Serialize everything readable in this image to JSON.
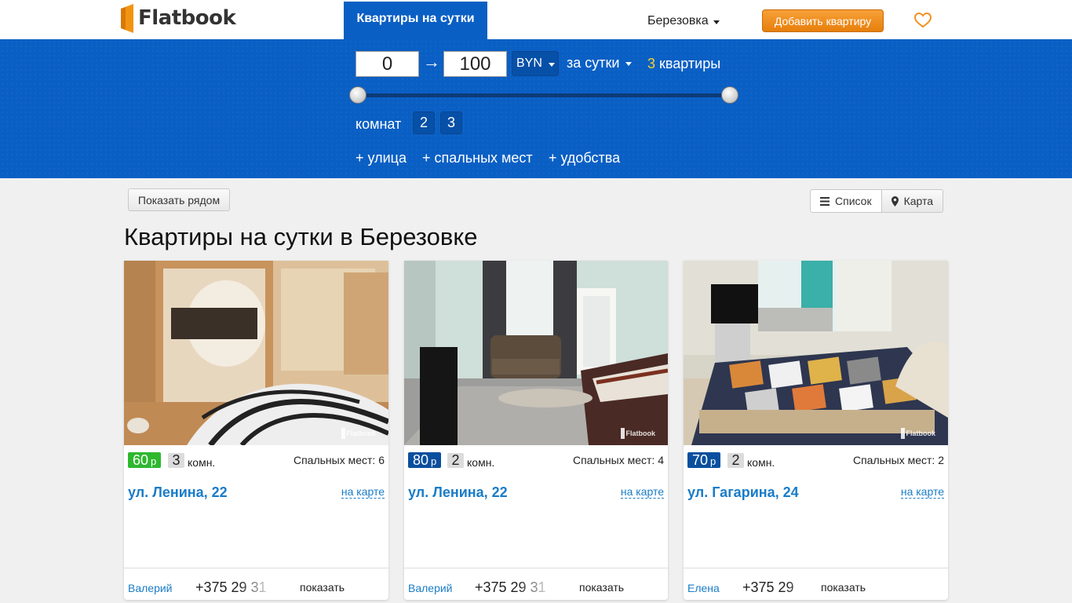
{
  "header": {
    "logo_text": "Flatbook",
    "nav_tab": "Квартиры на сутки",
    "city": "Березовка",
    "add_button": "Добавить квартиру"
  },
  "filters": {
    "price_from": "0",
    "arrow": "→",
    "price_to": "100",
    "currency": "BYN",
    "period": "за сутки",
    "count_number": "3",
    "count_label": "квартиры",
    "slider": {
      "min": 0,
      "max": 100
    },
    "rooms_label": "комнат",
    "rooms": [
      "2",
      "3"
    ],
    "extras": [
      "+ улица",
      "+ спальных мест",
      "+ удобства"
    ]
  },
  "toolbar": {
    "near_button": "Показать рядом",
    "list_button": "Список",
    "map_button": "Карта"
  },
  "page_title": "Квартиры на сутки в Березовке",
  "watermark": "Flatbook",
  "listings": [
    {
      "price": "60",
      "price_currency": "р",
      "price_color": "#2eb82e",
      "rooms": "3",
      "rooms_unit": "комн.",
      "beds": "Спальных мест: 6",
      "street": "ул. Ленина, 22",
      "map_link": "на карте",
      "owner": "Валерий",
      "phone": "+375 29 31",
      "show": "показать"
    },
    {
      "price": "80",
      "price_currency": "р",
      "price_color": "#0a4f9e",
      "rooms": "2",
      "rooms_unit": "комн.",
      "beds": "Спальных мест: 4",
      "street": "ул. Ленина, 22",
      "map_link": "на карте",
      "owner": "Валерий",
      "phone": "+375 29 31",
      "show": "показать"
    },
    {
      "price": "70",
      "price_currency": "р",
      "price_color": "#0a4f9e",
      "rooms": "2",
      "rooms_unit": "комн.",
      "beds": "Спальных мест: 2",
      "street": "ул. Гагарина, 24",
      "map_link": "на карте",
      "owner": "Елена",
      "phone": "+375 29",
      "show": "показать"
    }
  ],
  "colors": {
    "brand_blue": "#0a5fc4",
    "accent_orange": "#f0921f",
    "link_blue": "#1a7cc7",
    "count_yellow": "#f5d22b"
  }
}
